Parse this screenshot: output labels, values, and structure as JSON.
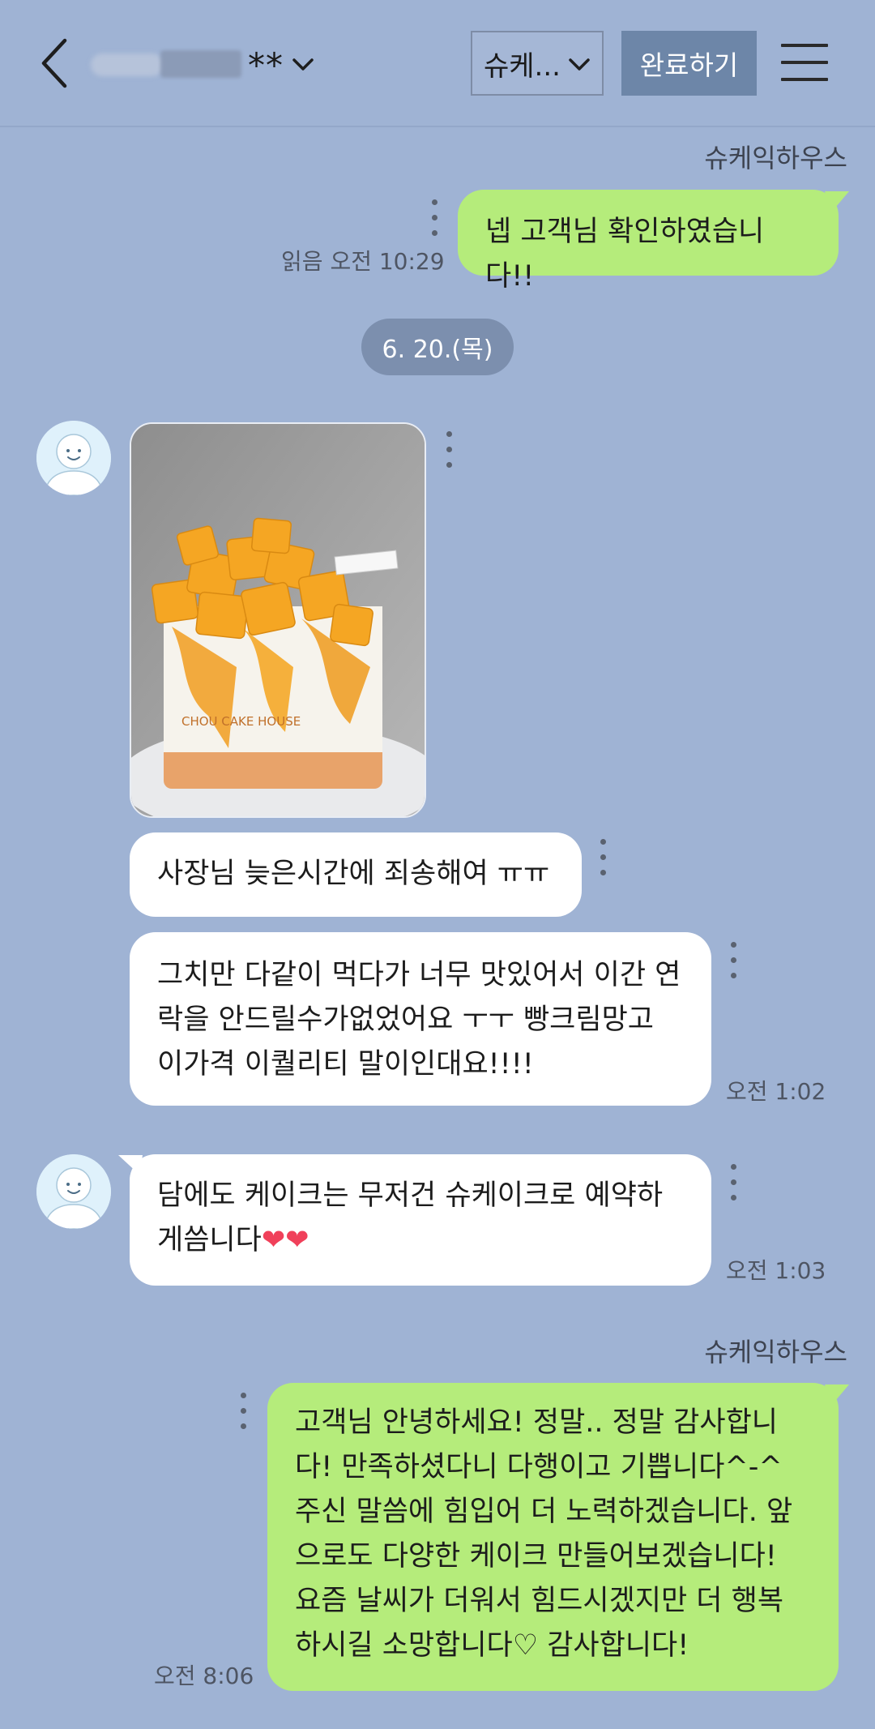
{
  "header": {
    "title_masked": "**",
    "room_select_label": "슈케...",
    "done_label": "완료하기"
  },
  "messages": {
    "m1": {
      "sender": "슈케익하우스",
      "text": "넵 고객님 확인하였습니다!!",
      "read": "읽음",
      "time": "오전 10:29"
    },
    "date": "6. 20.(목)",
    "m2": {
      "photo_caption": "CHOU CAKE HOUSE"
    },
    "m3": {
      "text": "사장님 늦은시간에 죄송해여 ㅠㅠ"
    },
    "m4": {
      "lines": [
        "그치만 다같이 먹다가 너무 맛있어서 이간 연",
        "락을 안드릴수가없었어요 ㅜㅜ 빵크림망고",
        "이가격 이퀄리티 말이인대요!!!!"
      ],
      "time": "오전 1:02"
    },
    "m5": {
      "lines": [
        "담에도 케이크는 무저건 슈케이크로 예약하",
        "게씀니다"
      ],
      "emoji": "❤❤",
      "time": "오전 1:03"
    },
    "m6": {
      "sender": "슈케익하우스",
      "lines": [
        "고객님 안녕하세요! 정말.. 정말 감사합니",
        "다! 만족하셨다니 다행이고 기쁩니다^-^",
        "주신 말씀에 힘입어 더 노력하겠습니다. 앞",
        "으로도 다양한 케이크 만들어보겠습니다!",
        "요즘 날씨가 더워서 힘드시겠지만 더 행복",
        "하시길 소망합니다♡ 감사합니다!"
      ],
      "time": "오전 8:06"
    }
  },
  "icons": {
    "back": "chevron-left-icon",
    "menu": "hamburger-menu-icon",
    "more": "vertical-dots-icon",
    "avatar": "default-profile-icon"
  },
  "colors": {
    "background": "#9fb3d4",
    "outgoing_bubble": "#b5ec7b",
    "incoming_bubble": "#ffffff",
    "done_button": "#6d86a8",
    "date_pill": "#7c8fae"
  }
}
